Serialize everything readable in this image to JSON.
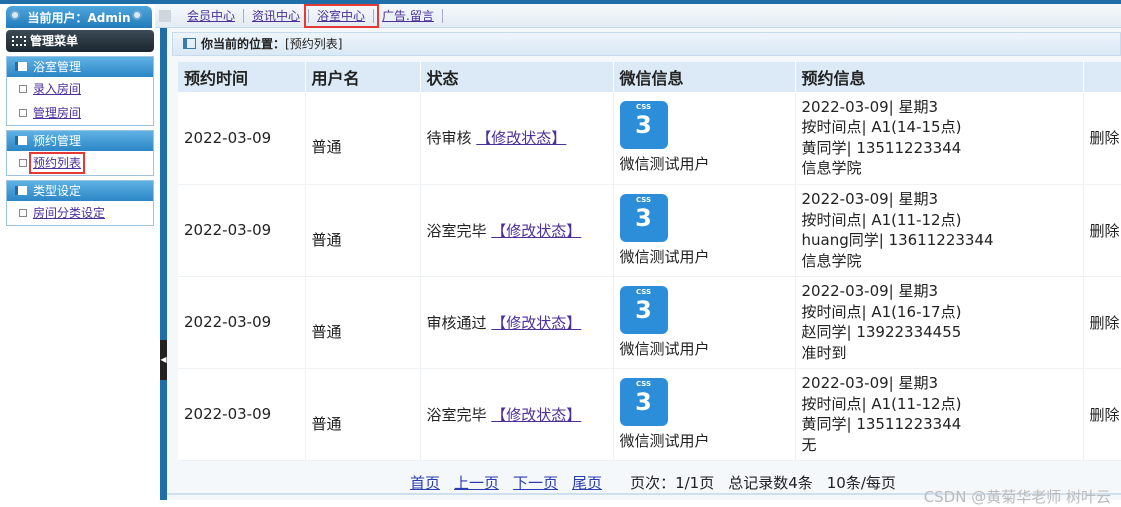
{
  "header": {
    "current_user": "当前用户：Admin"
  },
  "topnav": [
    "会员中心",
    "资讯中心",
    "浴室中心",
    "广告.留言"
  ],
  "sidebar": {
    "title": "管理菜单",
    "groups": [
      {
        "title": "浴室管理",
        "items": [
          "录入房间",
          "管理房间"
        ]
      },
      {
        "title": "预约管理",
        "items": [
          "预约列表"
        ]
      },
      {
        "title": "类型设定",
        "items": [
          "房间分类设定"
        ]
      }
    ]
  },
  "breadcrumb": {
    "label": "你当前的位置：",
    "page": "[预约列表]"
  },
  "table": {
    "headers": [
      "预约时间",
      "用户名",
      "状态",
      "微信信息",
      "预约信息",
      ""
    ],
    "rows": [
      {
        "time": "2022-03-09",
        "user": "普通",
        "status": "待审核",
        "edit": "【修改状态】",
        "wx": "微信测试用户",
        "info": [
          "2022-03-09| 星期3",
          "按时间点| A1(14-15点)",
          "黄同学| 13511223344",
          "信息学院"
        ],
        "del": "删除"
      },
      {
        "time": "2022-03-09",
        "user": "普通",
        "status": "浴室完毕",
        "edit": "【修改状态】",
        "wx": "微信测试用户",
        "info": [
          "2022-03-09| 星期3",
          "按时间点| A1(11-12点)",
          "huang同学| 13611223344",
          "信息学院"
        ],
        "del": "删除"
      },
      {
        "time": "2022-03-09",
        "user": "普通",
        "status": "审核通过",
        "edit": "【修改状态】",
        "wx": "微信测试用户",
        "info": [
          "2022-03-09| 星期3",
          "按时间点| A1(16-17点)",
          "赵同学| 13922334455",
          "准时到"
        ],
        "del": "删除"
      },
      {
        "time": "2022-03-09",
        "user": "普通",
        "status": "浴室完毕",
        "edit": "【修改状态】",
        "wx": "微信测试用户",
        "info": [
          "2022-03-09| 星期3",
          "按时间点| A1(11-12点)",
          "黄同学| 13511223344",
          "无"
        ],
        "del": "删除"
      }
    ]
  },
  "pager": {
    "first": "首页",
    "prev": "上一页",
    "next": "下一页",
    "last": "尾页",
    "pages": "页次：1/1页",
    "total": "总记录数4条",
    "per": "10条/每页"
  },
  "watermark": "CSDN @黄菊华老师  树叶云",
  "icon_label": "CSS"
}
